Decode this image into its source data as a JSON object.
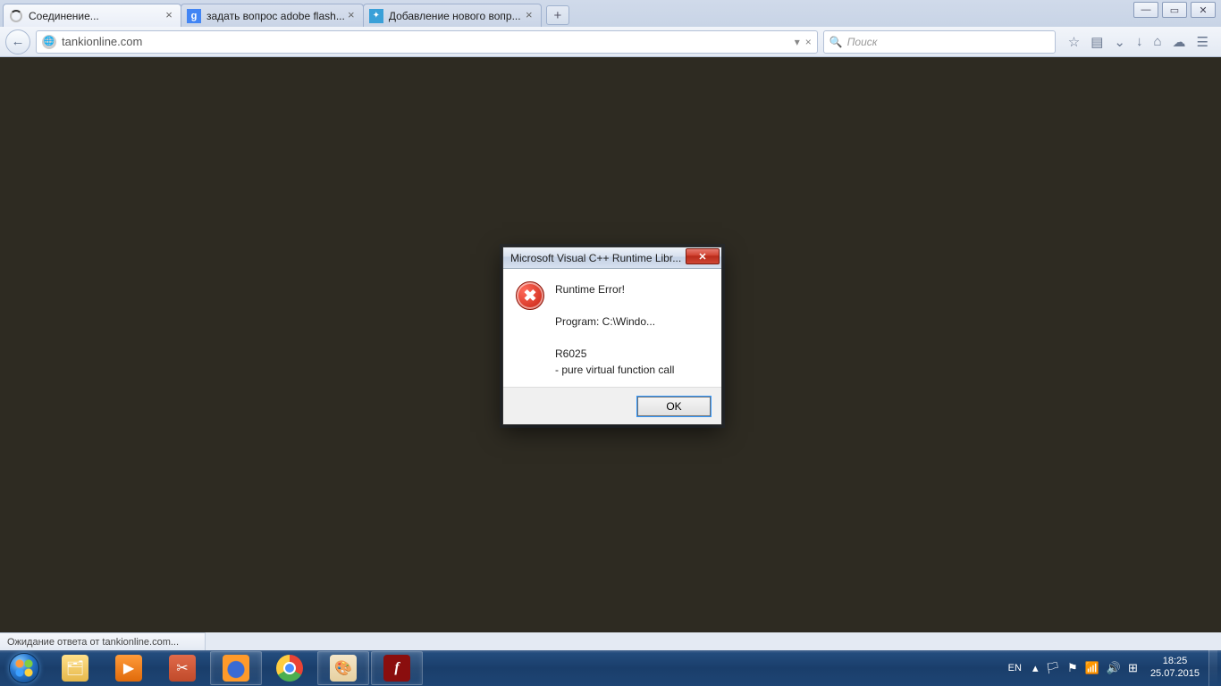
{
  "tabs": [
    {
      "label": "Соединение..."
    },
    {
      "label": "задать вопрос adobe flash..."
    },
    {
      "label": "Добавление нового вопр..."
    }
  ],
  "navbar": {
    "url": "tankionline.com",
    "search_placeholder": "Поиск"
  },
  "statusbar": {
    "text": "Ожидание ответа от tankionline.com..."
  },
  "dialog": {
    "title": "Microsoft Visual C++ Runtime Libr...",
    "heading": "Runtime Error!",
    "program_line": "Program: C:\\Windo...",
    "code_line": "R6025",
    "detail_line": "- pure virtual function call",
    "ok": "OK"
  },
  "tray": {
    "lang": "EN",
    "time": "18:25",
    "date": "25.07.2015"
  }
}
